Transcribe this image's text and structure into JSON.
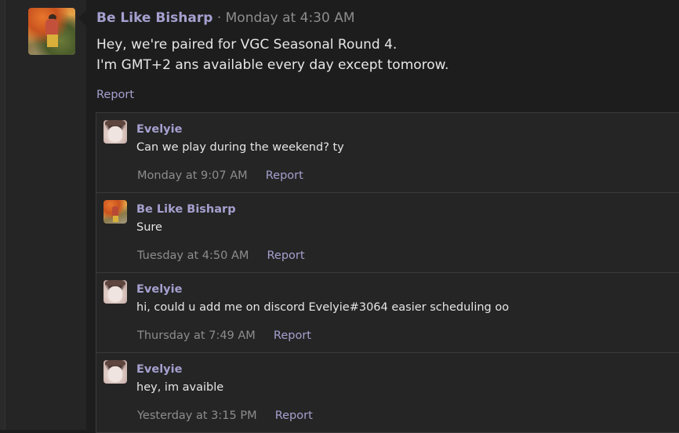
{
  "post": {
    "author": "Be Like Bisharp",
    "separator": "·",
    "time": "Monday at 4:30 AM",
    "lines": [
      "Hey, we're paired for VGC Seasonal Round 4.",
      "I'm GMT+2 ans available every day except tomorow."
    ],
    "report_label": "Report",
    "avatar": "be-like-bisharp-avatar"
  },
  "replies": [
    {
      "author": "Evelyie",
      "text": "Can we play during the weekend? ty",
      "time": "Monday at 9:07 AM",
      "report_label": "Report",
      "avatar": "evelyie-avatar"
    },
    {
      "author": "Be Like Bisharp",
      "text": "Sure",
      "time": "Tuesday at 4:50 AM",
      "report_label": "Report",
      "avatar": "be-like-bisharp-avatar"
    },
    {
      "author": "Evelyie",
      "text": "hi, could u add me on discord Evelyie#3064 easier scheduling oo",
      "time": "Thursday at 7:49 AM",
      "report_label": "Report",
      "avatar": "evelyie-avatar"
    },
    {
      "author": "Evelyie",
      "text": "hey, im avaible",
      "time": "Yesterday at 3:15 PM",
      "report_label": "Report",
      "avatar": "evelyie-avatar"
    }
  ],
  "colors": {
    "username": "#a5a0cf",
    "timestamp": "#8d8d8d",
    "text": "#e6e6e6",
    "background": "#1d1d1d",
    "reply_background": "#252525"
  }
}
